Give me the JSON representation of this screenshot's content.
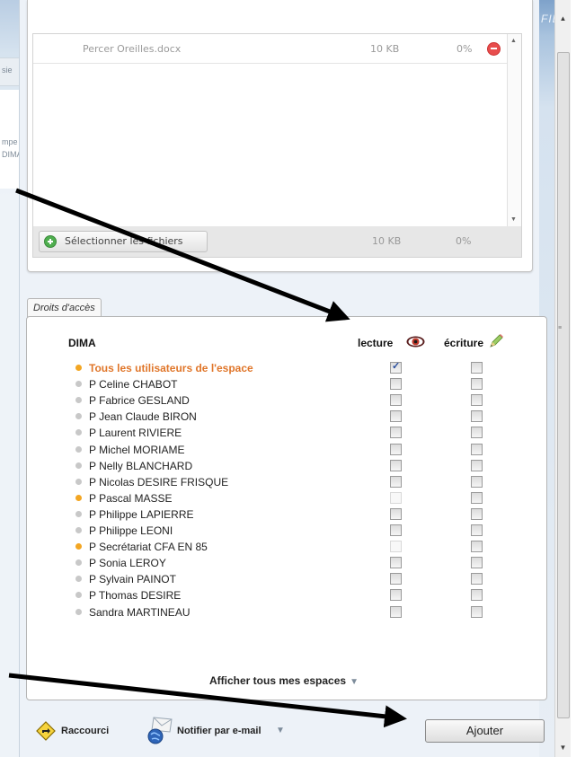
{
  "background": {
    "left_fragments": [
      "sie",
      "mpe",
      "DIMA"
    ],
    "right_fragment": "FILI"
  },
  "upload": {
    "files": [
      {
        "name": "Percer Oreilles.docx",
        "size": "10 KB",
        "progress": "0%"
      }
    ],
    "select_files_label": "Sélectionner les fichiers",
    "total_size": "10 KB",
    "total_progress": "0%"
  },
  "access": {
    "tab_label": "Droits d'accès",
    "space_name": "DIMA",
    "read_label": "lecture",
    "write_label": "écriture",
    "users": [
      {
        "name": "Tous les utilisateurs de l'espace",
        "dot": "orange",
        "highlight": true,
        "read": true,
        "read_disabled": false,
        "write": false
      },
      {
        "name": "P Celine CHABOT",
        "dot": "grey",
        "highlight": false,
        "read": false,
        "read_disabled": false,
        "write": false
      },
      {
        "name": "P Fabrice GESLAND",
        "dot": "grey",
        "highlight": false,
        "read": false,
        "read_disabled": false,
        "write": false
      },
      {
        "name": "P Jean Claude BIRON",
        "dot": "grey",
        "highlight": false,
        "read": false,
        "read_disabled": false,
        "write": false
      },
      {
        "name": "P Laurent RIVIERE",
        "dot": "grey",
        "highlight": false,
        "read": false,
        "read_disabled": false,
        "write": false
      },
      {
        "name": "P Michel MORIAME",
        "dot": "grey",
        "highlight": false,
        "read": false,
        "read_disabled": false,
        "write": false
      },
      {
        "name": "P Nelly BLANCHARD",
        "dot": "grey",
        "highlight": false,
        "read": false,
        "read_disabled": false,
        "write": false
      },
      {
        "name": "P Nicolas DESIRE FRISQUE",
        "dot": "grey",
        "highlight": false,
        "read": false,
        "read_disabled": false,
        "write": false
      },
      {
        "name": "P Pascal MASSE",
        "dot": "orange",
        "highlight": false,
        "read": false,
        "read_disabled": true,
        "write": false
      },
      {
        "name": "P Philippe LAPIERRE",
        "dot": "grey",
        "highlight": false,
        "read": false,
        "read_disabled": false,
        "write": false
      },
      {
        "name": "P Philippe LEONI",
        "dot": "grey",
        "highlight": false,
        "read": false,
        "read_disabled": false,
        "write": false
      },
      {
        "name": "P Secrétariat CFA EN 85",
        "dot": "orange",
        "highlight": false,
        "read": false,
        "read_disabled": true,
        "write": false
      },
      {
        "name": "P Sonia LEROY",
        "dot": "grey",
        "highlight": false,
        "read": false,
        "read_disabled": false,
        "write": false
      },
      {
        "name": "P Sylvain PAINOT",
        "dot": "grey",
        "highlight": false,
        "read": false,
        "read_disabled": false,
        "write": false
      },
      {
        "name": "P Thomas DESIRE",
        "dot": "grey",
        "highlight": false,
        "read": false,
        "read_disabled": false,
        "write": false
      },
      {
        "name": "Sandra MARTINEAU",
        "dot": "grey",
        "highlight": false,
        "read": false,
        "read_disabled": false,
        "write": false
      }
    ],
    "show_all_label": "Afficher tous mes espaces"
  },
  "footer": {
    "shortcut_label": "Raccourci",
    "notify_label": "Notifier par e-mail",
    "add_label": "Ajouter"
  },
  "colors": {
    "highlight": "#e0762a",
    "orange_dot": "#f3a623",
    "grey_dot": "#c8c8c8"
  }
}
